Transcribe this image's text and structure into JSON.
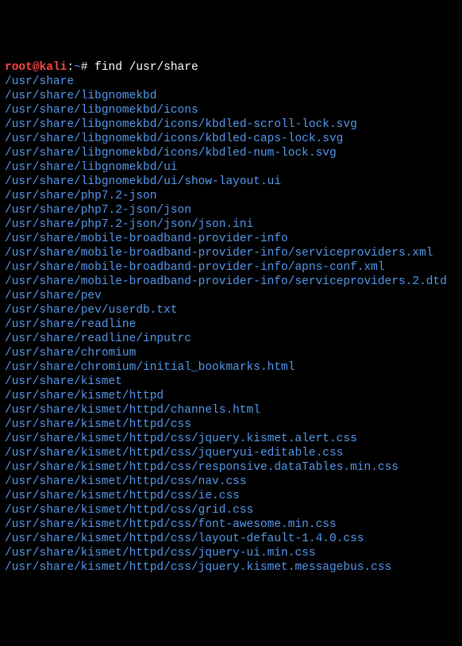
{
  "prompt": {
    "user": "root",
    "at": "@",
    "host": "kali",
    "colon": ":",
    "path": "~",
    "hash": "# "
  },
  "command": "find /usr/share",
  "output_lines": [
    "/usr/share",
    "/usr/share/libgnomekbd",
    "/usr/share/libgnomekbd/icons",
    "/usr/share/libgnomekbd/icons/kbdled-scroll-lock.svg",
    "/usr/share/libgnomekbd/icons/kbdled-caps-lock.svg",
    "/usr/share/libgnomekbd/icons/kbdled-num-lock.svg",
    "/usr/share/libgnomekbd/ui",
    "/usr/share/libgnomekbd/ui/show-layout.ui",
    "/usr/share/php7.2-json",
    "/usr/share/php7.2-json/json",
    "/usr/share/php7.2-json/json/json.ini",
    "/usr/share/mobile-broadband-provider-info",
    "/usr/share/mobile-broadband-provider-info/serviceproviders.xml",
    "/usr/share/mobile-broadband-provider-info/apns-conf.xml",
    "/usr/share/mobile-broadband-provider-info/serviceproviders.2.dtd",
    "/usr/share/pev",
    "/usr/share/pev/userdb.txt",
    "/usr/share/readline",
    "/usr/share/readline/inputrc",
    "/usr/share/chromium",
    "/usr/share/chromium/initial_bookmarks.html",
    "/usr/share/kismet",
    "/usr/share/kismet/httpd",
    "/usr/share/kismet/httpd/channels.html",
    "/usr/share/kismet/httpd/css",
    "/usr/share/kismet/httpd/css/jquery.kismet.alert.css",
    "/usr/share/kismet/httpd/css/jqueryui-editable.css",
    "/usr/share/kismet/httpd/css/responsive.dataTables.min.css",
    "/usr/share/kismet/httpd/css/nav.css",
    "/usr/share/kismet/httpd/css/ie.css",
    "/usr/share/kismet/httpd/css/grid.css",
    "/usr/share/kismet/httpd/css/font-awesome.min.css",
    "/usr/share/kismet/httpd/css/layout-default-1.4.0.css",
    "/usr/share/kismet/httpd/css/jquery-ui.min.css",
    "/usr/share/kismet/httpd/css/jquery.kismet.messagebus.css"
  ]
}
